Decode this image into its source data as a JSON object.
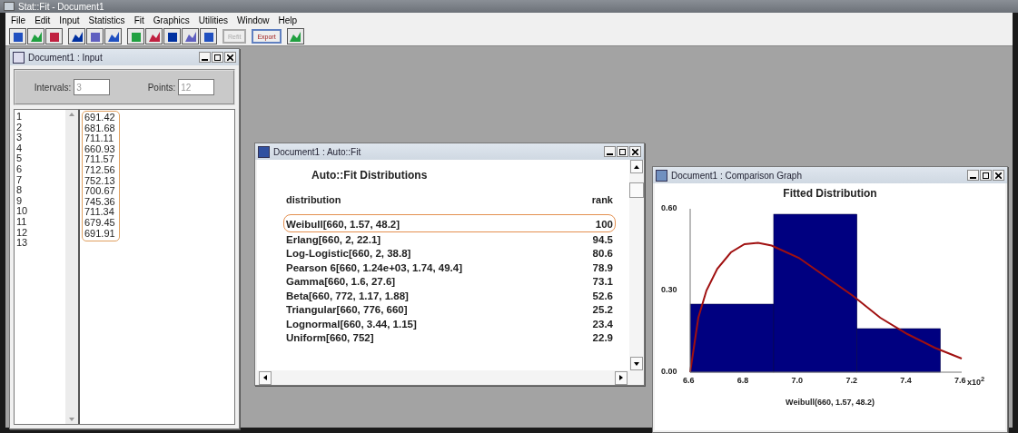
{
  "app_title": "Stat::Fit - Document1",
  "menu": [
    "File",
    "Edit",
    "Input",
    "Statistics",
    "Fit",
    "Graphics",
    "Utilities",
    "Window",
    "Help"
  ],
  "toolbar": [
    {
      "kind": "icon-group"
    },
    {
      "kind": "icon-group"
    },
    {
      "kind": "icon-group"
    },
    {
      "kind": "text",
      "label": "Refit",
      "disabled": true
    },
    {
      "kind": "text",
      "label": "Export",
      "disabled": false
    },
    {
      "kind": "icon-group"
    }
  ],
  "input_window": {
    "title": "Document1 : Input",
    "intervals_label": "Intervals:",
    "intervals": "3",
    "points_label": "Points:",
    "points": "12",
    "highlighted": true,
    "rows": [
      {
        "n": "1",
        "value": "691.42"
      },
      {
        "n": "2",
        "value": "681.68"
      },
      {
        "n": "3",
        "value": "711.11"
      },
      {
        "n": "4",
        "value": "660.93"
      },
      {
        "n": "5",
        "value": "711.57"
      },
      {
        "n": "6",
        "value": "712.56"
      },
      {
        "n": "7",
        "value": "752.13"
      },
      {
        "n": "8",
        "value": "700.67"
      },
      {
        "n": "9",
        "value": "745.36"
      },
      {
        "n": "10",
        "value": "711.34"
      },
      {
        "n": "11",
        "value": "679.45"
      },
      {
        "n": "12",
        "value": "691.91"
      },
      {
        "n": "13"
      }
    ]
  },
  "autofit_window": {
    "title": "Document1 : Auto::Fit",
    "heading": "Auto::Fit Distributions",
    "columns": [
      "distribution",
      "rank"
    ],
    "rows": [
      {
        "distribution": "Weibull[660, 1.57, 48.2]",
        "rank": "100",
        "selected": true
      },
      {
        "distribution": "Erlang[660, 2, 22.1]",
        "rank": "94.5",
        "selected": false
      },
      {
        "distribution": "Log-Logistic[660, 2, 38.8]",
        "rank": "80.6",
        "selected": false
      },
      {
        "distribution": "Pearson 6[660, 1.24e+03, 1.74, 49.4]",
        "rank": "78.9",
        "selected": false
      },
      {
        "distribution": "Gamma[660, 1.6, 27.6]",
        "rank": "73.1",
        "selected": false
      },
      {
        "distribution": "Beta[660, 772, 1.17, 1.88]",
        "rank": "52.6",
        "selected": false
      },
      {
        "distribution": "Triangular[660, 776, 660]",
        "rank": "25.2",
        "selected": false
      },
      {
        "distribution": "Lognormal[660, 3.44, 1.15]",
        "rank": "23.4",
        "selected": false
      },
      {
        "distribution": "Uniform[660, 752]",
        "rank": "22.9",
        "selected": false
      }
    ]
  },
  "graph_window": {
    "title": "Document1 : Comparison Graph",
    "x_multiplier": "x10$^{2}$",
    "chart_data": {
      "type": "bar",
      "title": "Fitted Distribution",
      "xlabel": "Weibull(660, 1.57, 48.2)",
      "x": [
        6.754,
        7.061,
        7.368
      ],
      "series": [
        {
          "color": "#000080",
          "values": [
            0.25,
            0.58,
            0.16
          ]
        },
        {
          "type": "line",
          "color": "#a01010",
          "x": [
            6.6,
            6.63,
            6.66,
            6.7,
            6.75,
            6.8,
            6.85,
            6.9,
            7.0,
            7.1,
            7.2,
            7.3,
            7.4,
            7.5,
            7.6
          ],
          "values": [
            0,
            0.2,
            0.3,
            0.38,
            0.44,
            0.47,
            0.475,
            0.465,
            0.42,
            0.35,
            0.28,
            0.2,
            0.14,
            0.09,
            0.05
          ]
        }
      ],
      "xlim": [
        6.6,
        7.6
      ],
      "ylim": [
        0,
        0.6
      ],
      "xticks": [
        {
          "value": 6.6,
          "label": "6.6"
        },
        {
          "value": 6.8,
          "label": "6.8"
        },
        {
          "value": 7.0,
          "label": "7.0"
        },
        {
          "value": 7.2,
          "label": "7.2"
        },
        {
          "value": 7.4,
          "label": "7.4"
        },
        {
          "value": 7.6,
          "label": "7.6"
        }
      ],
      "yticks": [
        {
          "value": 0,
          "label": "0.00"
        },
        {
          "value": 0.3,
          "label": "0.30"
        },
        {
          "value": 0.6,
          "label": "0.60"
        }
      ]
    }
  }
}
